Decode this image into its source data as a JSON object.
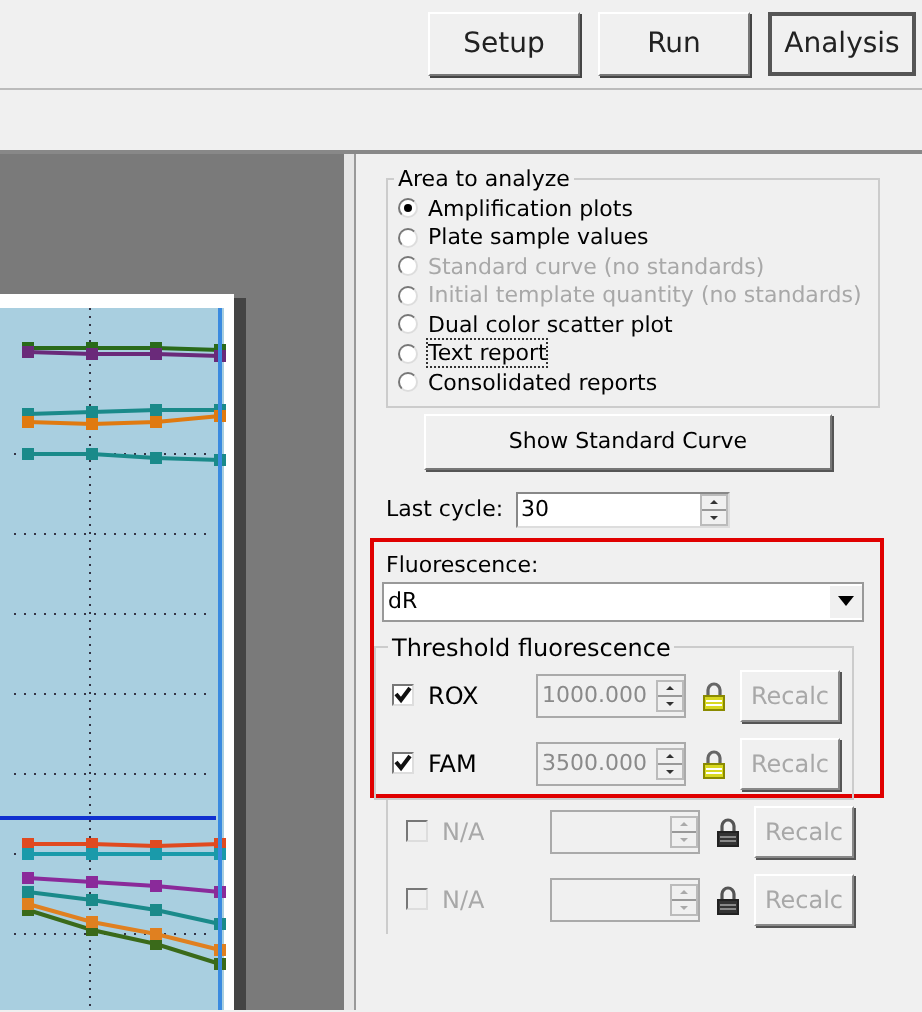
{
  "toolbar": {
    "buttons": [
      {
        "label": "Setup",
        "selected": false
      },
      {
        "label": "Run",
        "selected": false
      },
      {
        "label": "Analysis",
        "selected": true
      }
    ]
  },
  "area_to_analyze": {
    "title": "Area to analyze",
    "options": [
      {
        "label": "Amplification plots",
        "selected": true,
        "disabled": false,
        "focused": false
      },
      {
        "label": "Plate sample values",
        "selected": false,
        "disabled": false,
        "focused": false
      },
      {
        "label": "Standard curve (no standards)",
        "selected": false,
        "disabled": true,
        "focused": false
      },
      {
        "label": "Initial template quantity (no standards)",
        "selected": false,
        "disabled": true,
        "focused": false
      },
      {
        "label": "Dual color scatter plot",
        "selected": false,
        "disabled": false,
        "focused": false
      },
      {
        "label": "Text report",
        "selected": false,
        "disabled": false,
        "focused": true
      },
      {
        "label": "Consolidated reports",
        "selected": false,
        "disabled": false,
        "focused": false
      }
    ]
  },
  "show_standard_curve_button": "Show Standard Curve",
  "last_cycle": {
    "label": "Last cycle:",
    "value": "30"
  },
  "fluorescence": {
    "label": "Fluorescence:",
    "value": "dR"
  },
  "threshold": {
    "title": "Threshold fluorescence",
    "rows": [
      {
        "dye": "ROX",
        "checked": true,
        "disabled": false,
        "value": "1000.000",
        "button": "Recalc"
      },
      {
        "dye": "FAM",
        "checked": true,
        "disabled": false,
        "value": "3500.000",
        "button": "Recalc"
      },
      {
        "dye": "N/A",
        "checked": false,
        "disabled": true,
        "button": "Recalc"
      },
      {
        "dye": "N/A",
        "checked": false,
        "disabled": true,
        "button": "Recalc"
      }
    ]
  }
}
